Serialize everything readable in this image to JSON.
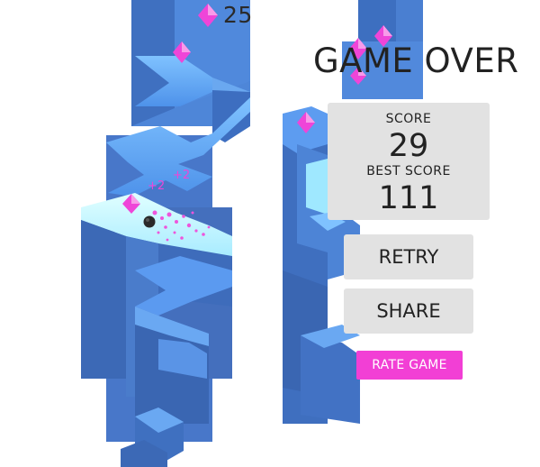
{
  "hud": {
    "gem_count": "25",
    "gem_icon": "pink-diamond-icon"
  },
  "game_over": {
    "title": "GAME OVER",
    "score_label": "SCORE",
    "score_value": "29",
    "best_label": "BEST SCORE",
    "best_value": "111"
  },
  "buttons": {
    "retry": "RETRY",
    "share": "SHARE",
    "rate": "RATE GAME"
  },
  "popups": [
    "+2",
    "+2"
  ],
  "colors": {
    "block_top": "#56a0ff",
    "block_side_left": "#3f73c8",
    "block_side_right": "#4a7fd1",
    "gem": "#ee42d6",
    "ball": "#2a2a2a",
    "rate_button": "#f23fd5",
    "panel": "#e2e2e2"
  }
}
